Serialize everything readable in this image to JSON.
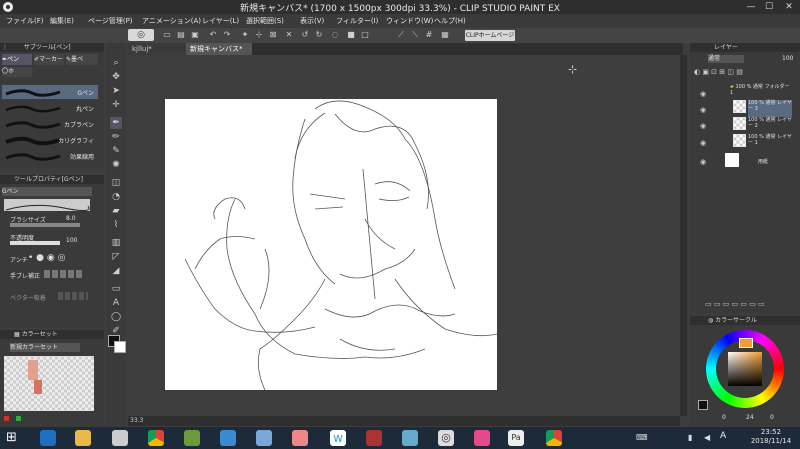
{
  "window": {
    "title": "新規キャンバス* (1700 x 1500px 300dpi 33.3%)  - CLIP STUDIO PAINT EX",
    "minimize": "—",
    "maximize": "☐",
    "close": "✕"
  },
  "menu": {
    "items": [
      "ファイル(F)",
      "編集(E)",
      "ページ管理(P)",
      "アニメーション(A)",
      "レイヤー(L)",
      "選択範囲(S)",
      "表示(V)",
      "フィルター(I)",
      "ウィンドウ(W)",
      "ヘルプ(H)"
    ]
  },
  "command_bar": {
    "home_label": "CLIPホームページ"
  },
  "subtool_panel": {
    "title": "サブツール[ペン]",
    "tabs": [
      "ペン",
      "マーカー",
      "墨ペ"
    ],
    "active_tab_sub": "〇ホ",
    "brushes": [
      "Gペン",
      "丸ペン",
      "カブラペン",
      "カリグラフィ",
      "効果線用"
    ]
  },
  "tool_property": {
    "title": "ツールプロパティ[Gペン]",
    "tool_name": "Gペン",
    "brush_size_label": "ブラシサイズ",
    "brush_size_value": "8.0",
    "opacity_label": "不透明度",
    "opacity_value": "100",
    "antialias_label": "アンチ",
    "stabilization_label": "手ブレ補正",
    "vector_label": "ベクター吸着"
  },
  "color_set": {
    "title": "カラーセット",
    "set_name": "新規カラーセット"
  },
  "tabs": {
    "tab1": "kjlluj*",
    "tab2": "新規キャンバス*"
  },
  "canvas": {
    "zoom": "33.3"
  },
  "layer_panel": {
    "title": "レイヤー",
    "blend_mode": "通常",
    "opacity": "100",
    "layers": [
      {
        "name": "100 % 通常\nフォルダー 1"
      },
      {
        "name": "100 % 通常\nレイヤー 3"
      },
      {
        "name": "100 % 通常\nレイヤー 2"
      },
      {
        "name": "100 % 通常\nレイヤー 1"
      },
      {
        "name": "用紙"
      }
    ]
  },
  "color_wheel": {
    "title": "カラーサークル",
    "h_value": "0",
    "s_value": "24",
    "v_value": "0"
  },
  "taskbar": {
    "time": "23:52",
    "date": "2018/11/14",
    "ime": "A",
    "lang": "あ"
  },
  "colors": {
    "accent": "#4a90d9",
    "title_bg": "#2e2e2e",
    "panel_bg": "#3a3a3a",
    "canvas_bg": "#ffffff"
  }
}
